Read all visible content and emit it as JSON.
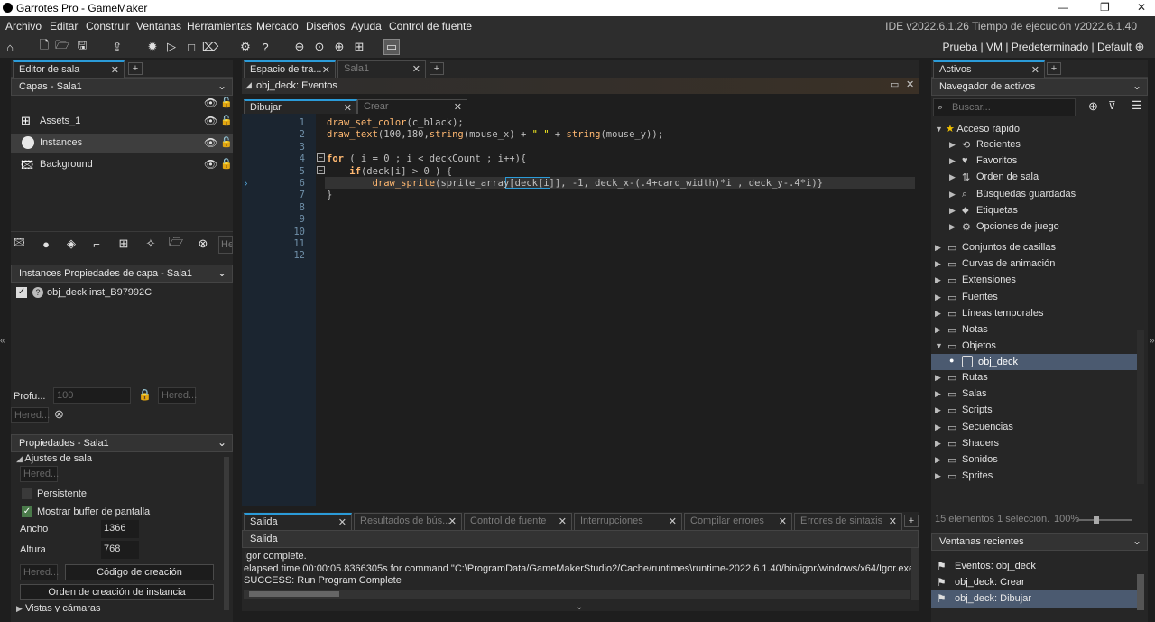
{
  "window": {
    "title": "Garrotes Pro - GameMaker",
    "minimize": "—",
    "maximize": "❐",
    "close": "✕"
  },
  "menu": [
    "Archivo",
    "Editar",
    "Construir",
    "Ventanas",
    "Herramientas",
    "Mercado",
    "Diseños",
    "Ayuda",
    "Control de fuente"
  ],
  "version": "IDE v2022.6.1.26  Tiempo de ejecución v2022.6.1.40",
  "targets": "Prueba | VM | Predeterminado | Default",
  "left": {
    "tab": "Editor de sala",
    "layers_header": "Capas - Sala1",
    "layers": [
      {
        "name": "Assets_1"
      },
      {
        "name": "Instances"
      },
      {
        "name": "Background"
      }
    ],
    "layer_props_header": "Instances Propiedades de capa - Sala1",
    "instance": {
      "name": "obj_deck",
      "id": "inst_B97992C"
    },
    "depth_label": "Profu...",
    "depth_value": "100",
    "inherit": "Hered...",
    "inherit2": "Hered...",
    "truncated": "He",
    "room_props_header": "Propiedades - Sala1",
    "room_settings": "Ajustes de sala",
    "inherit3": "Hered...",
    "persistent": "Persistente",
    "show_buffer": "Mostrar buffer de pantalla",
    "width_label": "Ancho",
    "width_value": "1366",
    "height_label": "Altura",
    "height_value": "768",
    "inherit4": "Hered...",
    "creation_code": "Código de creación",
    "instance_order": "Orden de creación de instancia",
    "views": "Vistas y cámaras"
  },
  "center": {
    "tabs": [
      {
        "label": "Espacio de tra...",
        "active": true
      },
      {
        "label": "Sala1",
        "active": false
      }
    ],
    "editor_title": "obj_deck: Eventos",
    "event_tabs": [
      {
        "label": "Dibujar",
        "active": true
      },
      {
        "label": "Crear",
        "active": false
      }
    ],
    "lines": [
      "1",
      "2",
      "3",
      "4",
      "5",
      "6",
      "7",
      "8",
      "9",
      "10",
      "11",
      "12"
    ],
    "code": [
      "draw_set_color(c_black);",
      "draw_text(100,180,string(mouse_x) + \" \" + string(mouse_y));",
      "",
      "for ( i = 0 ; i < deckCount ; i++){",
      "    if(deck[i] > 0 ) {",
      "        draw_sprite(sprite_array[deck[i]], -1, deck_x-(.4+card_width)*i , deck_y-.4*i)}",
      "}",
      "",
      "",
      "",
      "",
      ""
    ],
    "output_tabs": [
      "Salida",
      "Resultados de bús...",
      "Control de fuente",
      "Interrupciones",
      "Compilar errores",
      "Errores de sintaxis"
    ],
    "output_header": "Salida",
    "output_lines": [
      "Igor complete.",
      "elapsed time 00:00:05.8366305s for command \"C:\\ProgramData/GameMakerStudio2/Cache/runtimes\\runtime-2022.6.1.40/bin/igor/windows/x64/Igor.exe\" -j=",
      "SUCCESS: Run Program Complete"
    ]
  },
  "right": {
    "tab": "Activos",
    "browser": "Navegador de activos",
    "search_placeholder": "Buscar...",
    "quick": "Acceso rápido",
    "quick_items": [
      "Recientes",
      "Favoritos",
      "Orden de sala",
      "Búsquedas guardadas",
      "Etiquetas",
      "Opciones de juego"
    ],
    "groups": [
      "Conjuntos de casillas",
      "Curvas de animación",
      "Extensiones",
      "Fuentes",
      "Líneas temporales",
      "Notas",
      "Objetos"
    ],
    "obj_item": "obj_deck",
    "groups2": [
      "Rutas",
      "Salas",
      "Scripts",
      "Secuencias",
      "Shaders",
      "Sonidos",
      "Sprites"
    ],
    "status": "15 elementos   1 seleccion.",
    "zoom": "100%",
    "recent_header": "Ventanas recientes",
    "recent": [
      "Eventos: obj_deck",
      "obj_deck: Crear",
      "obj_deck: Dibujar"
    ]
  },
  "colors": {
    "accent": "#2b9bd8",
    "selection": "#4b5a70",
    "keyword": "#ffb871",
    "string": "#fcf320",
    "function": "#ffb871",
    "code_text": "#c0c0c0"
  }
}
